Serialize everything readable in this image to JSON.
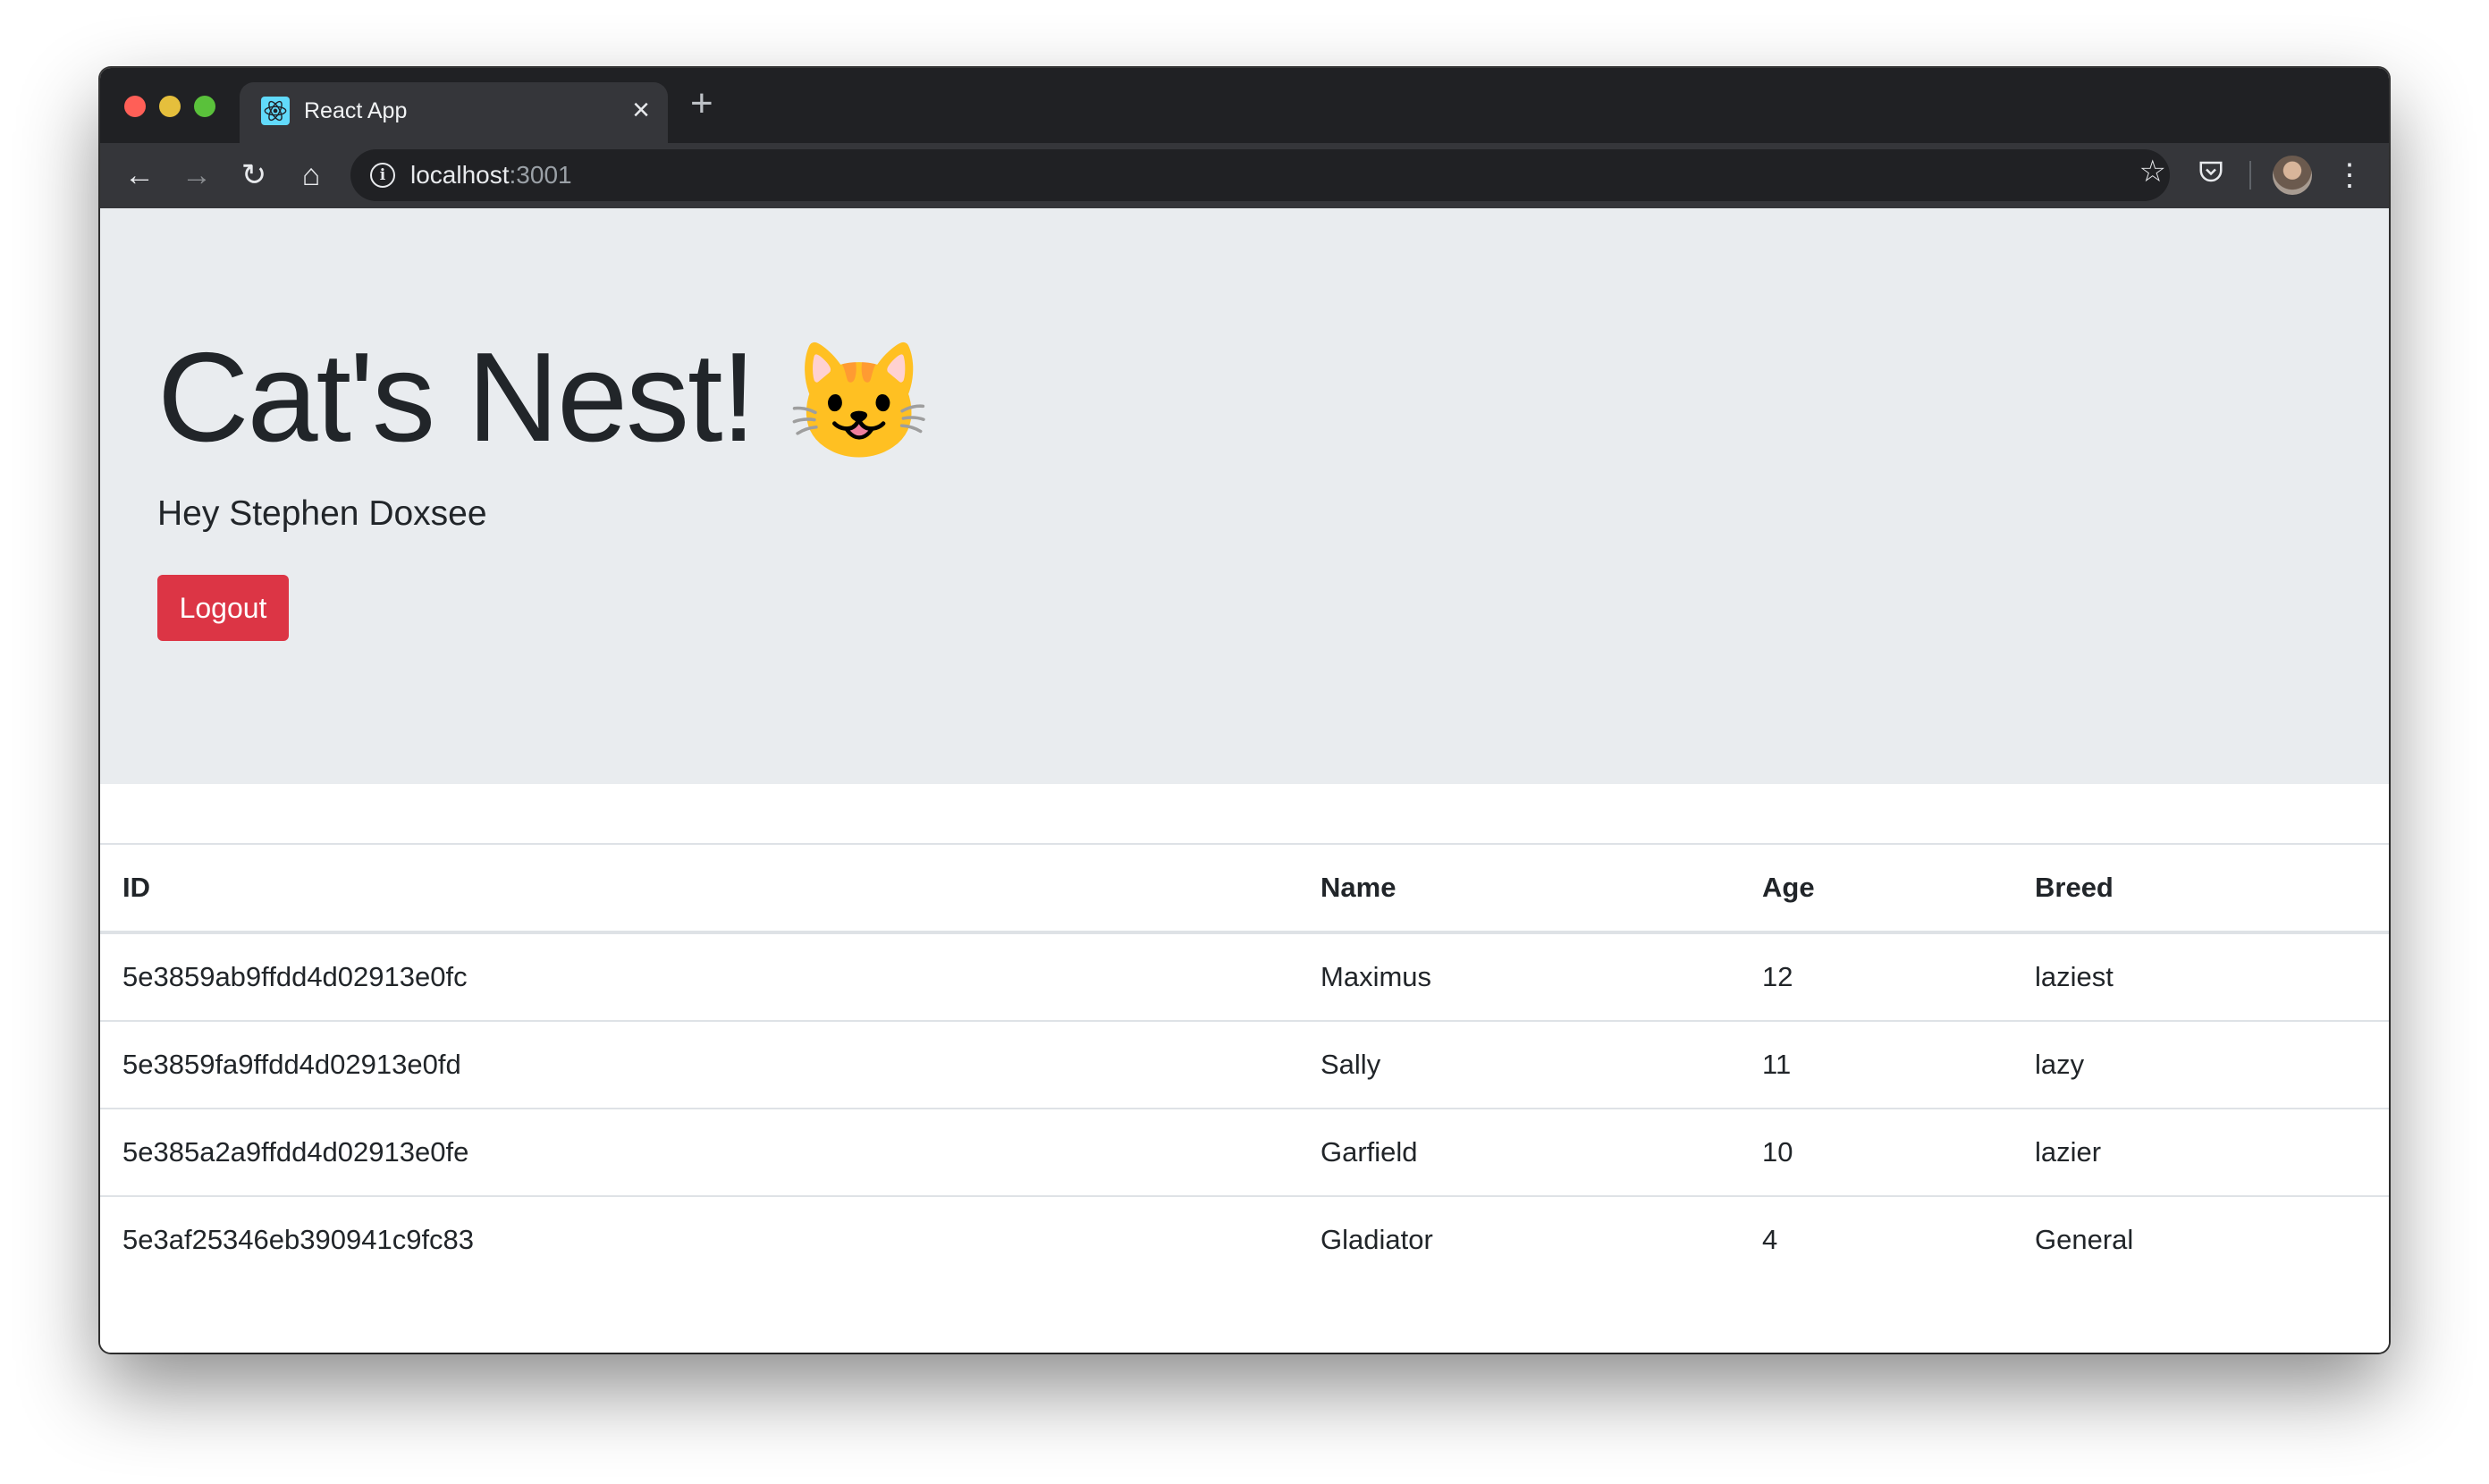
{
  "browser": {
    "tab_title": "React App",
    "url_host": "localhost",
    "url_port": ":3001",
    "icons": [
      "react-favicon",
      "close-icon",
      "plus-icon",
      "back-arrow-icon",
      "forward-arrow-icon",
      "reload-icon",
      "home-icon",
      "info-icon",
      "star-icon",
      "pocket-icon",
      "avatar",
      "kebab-menu-icon"
    ],
    "traffic_lights": {
      "close": "#ff5f57",
      "minimize": "#e5bf3c",
      "maximize": "#5ac13b"
    }
  },
  "hero": {
    "title": "Cat's Nest!",
    "emoji": "😺",
    "greeting": "Hey Stephen Doxsee",
    "logout_label": "Logout",
    "logout_color": "#dc3545",
    "background": "#e9ecef"
  },
  "table": {
    "headers": [
      "ID",
      "Name",
      "Age",
      "Breed"
    ],
    "rows": [
      [
        "5e3859ab9ffdd4d02913e0fc",
        "Maximus",
        "12",
        "laziest"
      ],
      [
        "5e3859fa9ffdd4d02913e0fd",
        "Sally",
        "11",
        "lazy"
      ],
      [
        "5e385a2a9ffdd4d02913e0fe",
        "Garfield",
        "10",
        "lazier"
      ],
      [
        "5e3af25346eb390941c9fc83",
        "Gladiator",
        "4",
        "General"
      ]
    ]
  }
}
